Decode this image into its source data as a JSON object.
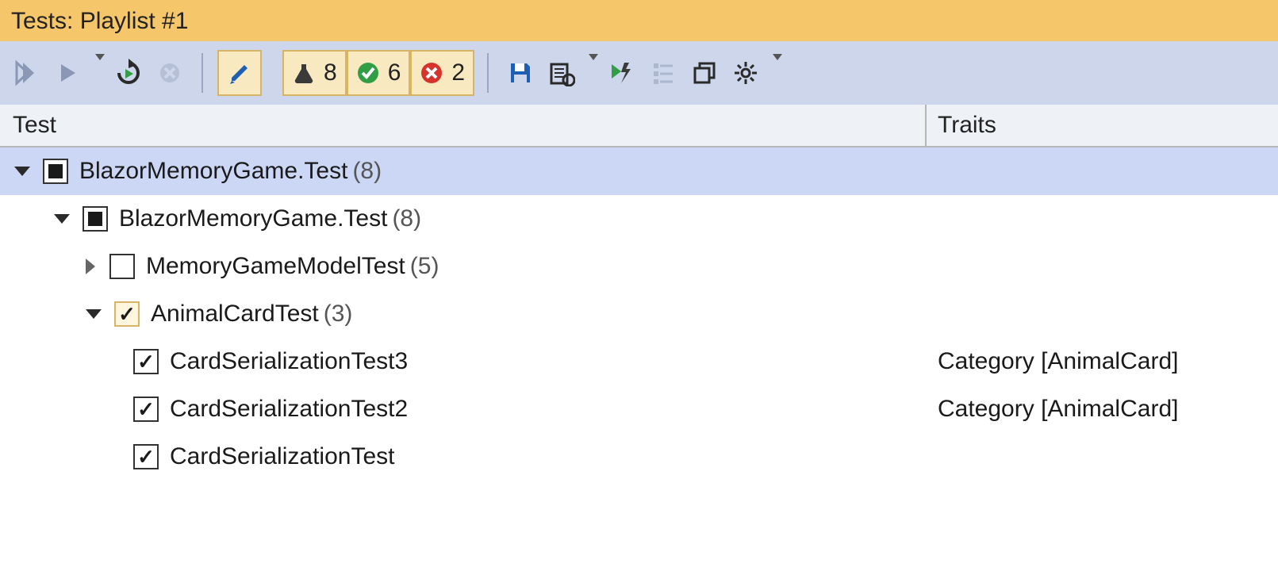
{
  "title": "Tests: Playlist #1",
  "toolbar": {
    "counts": {
      "total": "8",
      "passed": "6",
      "failed": "2"
    }
  },
  "columns": {
    "test": "Test",
    "traits": "Traits"
  },
  "tree": {
    "root": {
      "name": "BlazorMemoryGame.Test",
      "count": "(8)",
      "child": {
        "name": "BlazorMemoryGame.Test",
        "count": "(8)",
        "fixtures": [
          {
            "name": "MemoryGameModelTest",
            "count": "(5)"
          },
          {
            "name": "AnimalCardTest",
            "count": "(3)",
            "tests": [
              {
                "name": "CardSerializationTest3",
                "trait": "Category [AnimalCard]"
              },
              {
                "name": "CardSerializationTest2",
                "trait": "Category [AnimalCard]"
              },
              {
                "name": "CardSerializationTest",
                "trait": ""
              }
            ]
          }
        ]
      }
    }
  }
}
